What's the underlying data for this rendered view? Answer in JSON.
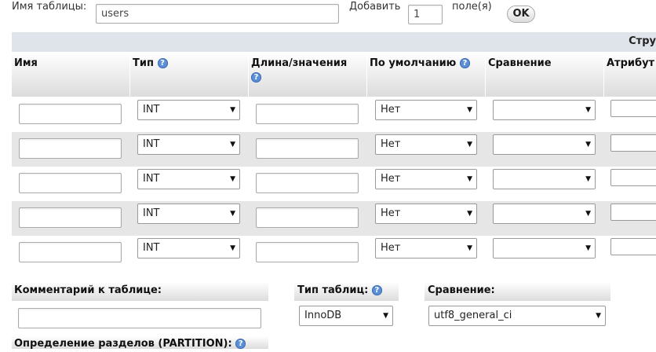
{
  "top": {
    "table_name_label": "Имя таблицы:",
    "table_name_value": "users",
    "add_label": "Добавить",
    "add_count": "1",
    "fields_label": "поле(я)",
    "ok_label": "OK"
  },
  "structure_bar": {
    "label": "Стру"
  },
  "columns": [
    {
      "label": "Имя",
      "help": false
    },
    {
      "label": "Тип",
      "help": true
    },
    {
      "label": "Длина/значения",
      "help": true
    },
    {
      "label": "По умолчанию",
      "help": true
    },
    {
      "label": "Сравнение",
      "help": false
    },
    {
      "label": "Атрибут",
      "help": false
    }
  ],
  "rows": [
    {
      "type": "INT",
      "default": "Нет"
    },
    {
      "type": "INT",
      "default": "Нет"
    },
    {
      "type": "INT",
      "default": "Нет"
    },
    {
      "type": "INT",
      "default": "Нет"
    },
    {
      "type": "INT",
      "default": "Нет"
    }
  ],
  "bottom": {
    "comment_label": "Комментарий к таблице:",
    "table_type_label": "Тип таблиц:",
    "table_type_value": "InnoDB",
    "collation_label": "Сравнение:",
    "collation_value": "utf8_general_ci",
    "partition_label": "Определение разделов (PARTITION):"
  },
  "icons": {
    "help": "?",
    "dropdown": "▼"
  }
}
